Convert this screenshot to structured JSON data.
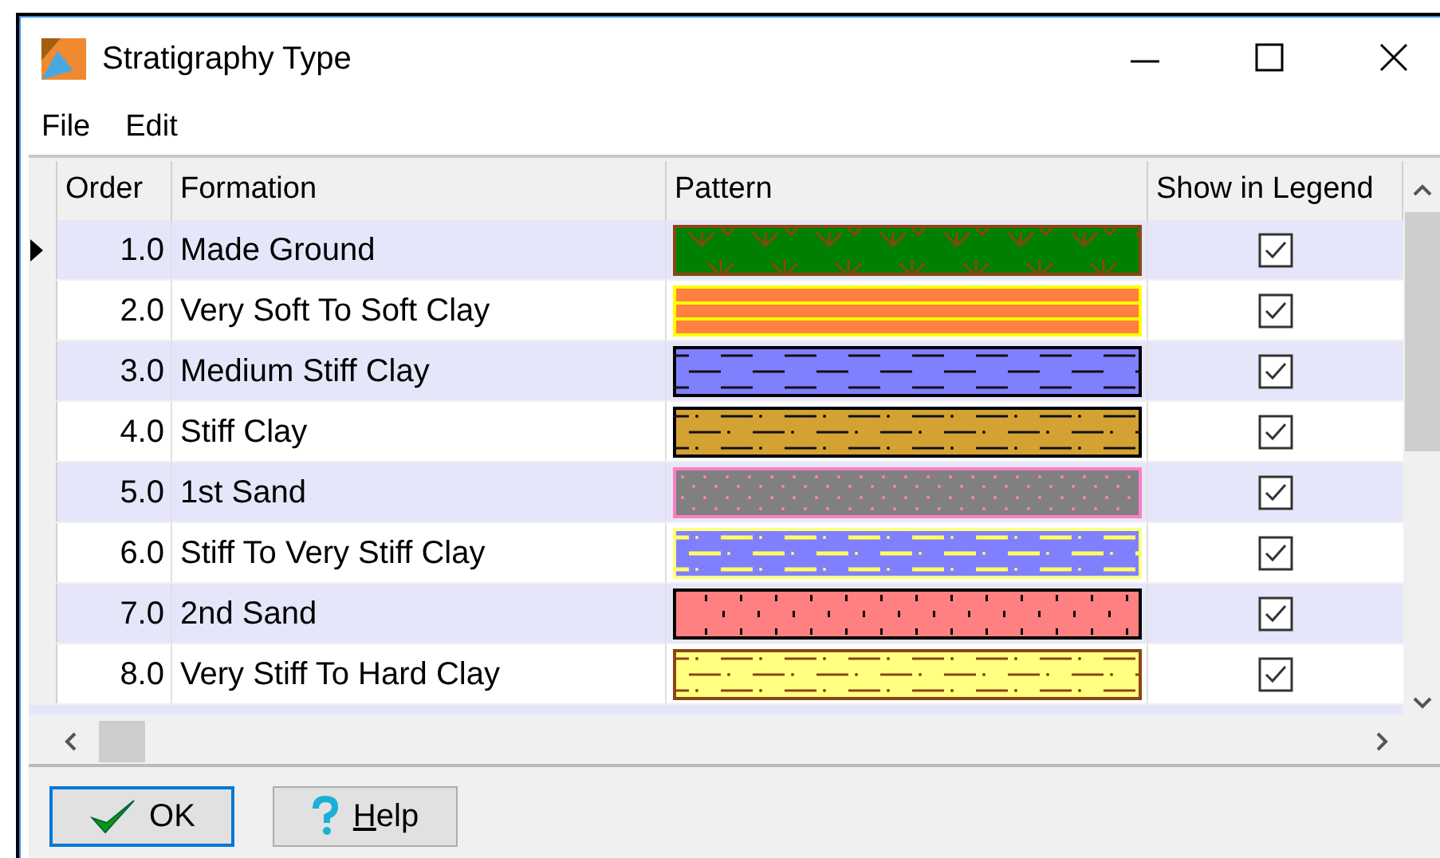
{
  "window": {
    "title": "Stratigraphy Type"
  },
  "menu": [
    "File",
    "Edit"
  ],
  "table": {
    "columns": [
      "Order",
      "Formation",
      "Pattern",
      "Show in Legend"
    ],
    "rows": [
      {
        "order": "1.0",
        "formation": "Made Ground",
        "pattern": {
          "kind": "grass",
          "color": "#008000"
        },
        "show_in_legend": true,
        "selected": true
      },
      {
        "order": "2.0",
        "formation": "Very Soft To Soft Clay",
        "pattern": {
          "kind": "stripes",
          "color": "#ff8040"
        },
        "show_in_legend": true,
        "selected": false
      },
      {
        "order": "3.0",
        "formation": "Medium Stiff Clay",
        "pattern": {
          "kind": "dashes",
          "color": "#8080ff"
        },
        "show_in_legend": true,
        "selected": false
      },
      {
        "order": "4.0",
        "formation": "Stiff Clay",
        "pattern": {
          "kind": "dash-dot",
          "color": "#d4a232"
        },
        "show_in_legend": true,
        "selected": false
      },
      {
        "order": "5.0",
        "formation": "1st Sand",
        "pattern": {
          "kind": "dots",
          "color": "#808080"
        },
        "show_in_legend": true,
        "selected": false
      },
      {
        "order": "6.0",
        "formation": "Stiff To Very Stiff Clay",
        "pattern": {
          "kind": "light-dash-dot",
          "color": "#8080ff"
        },
        "show_in_legend": true,
        "selected": false
      },
      {
        "order": "7.0",
        "formation": "2nd Sand",
        "pattern": {
          "kind": "ticks",
          "color": "#ff8080"
        },
        "show_in_legend": true,
        "selected": false
      },
      {
        "order": "8.0",
        "formation": "Very Stiff To Hard Clay",
        "pattern": {
          "kind": "fine-dash-dot",
          "color": "#ffff80"
        },
        "show_in_legend": true,
        "selected": false
      }
    ]
  },
  "buttons": [
    {
      "kind": "ok",
      "label": "OK"
    },
    {
      "kind": "help",
      "label": "**H**elp"
    }
  ]
}
